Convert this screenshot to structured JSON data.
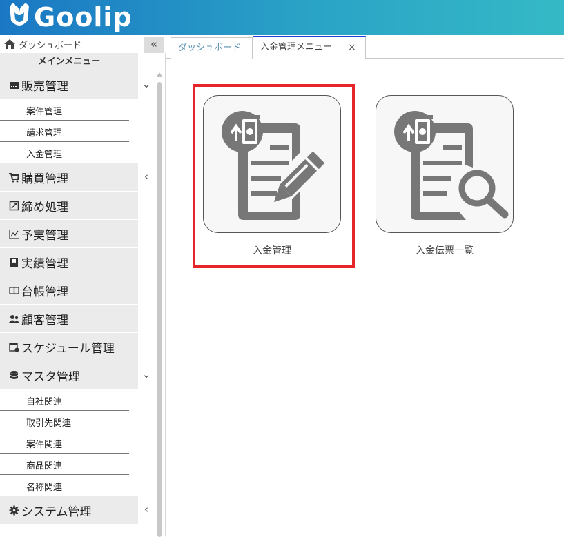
{
  "app": {
    "logo_text": "Goolip"
  },
  "sidebar": {
    "dashboard_label": "ダッシュボード",
    "collapse_label": "«",
    "main_menu_title": "メインメニュー",
    "categories": [
      {
        "label": "販売管理",
        "icon": "register-icon",
        "chevron": "⌄",
        "expanded": true,
        "items": [
          "案件管理",
          "請求管理",
          "入金管理"
        ]
      },
      {
        "label": "購買管理",
        "icon": "cart-icon",
        "chevron": "‹"
      },
      {
        "label": "締め処理",
        "icon": "checkbox-icon",
        "chevron": ""
      },
      {
        "label": "予実管理",
        "icon": "line-chart-icon",
        "chevron": ""
      },
      {
        "label": "実績管理",
        "icon": "bookmark-icon",
        "chevron": ""
      },
      {
        "label": "台帳管理",
        "icon": "book-icon",
        "chevron": ""
      },
      {
        "label": "顧客管理",
        "icon": "users-icon",
        "chevron": ""
      },
      {
        "label": "スケジュール管理",
        "icon": "calendar-icon",
        "chevron": ""
      },
      {
        "label": "マスタ管理",
        "icon": "database-icon",
        "chevron": "⌄",
        "expanded": true,
        "items": [
          "自社関連",
          "取引先関連",
          "案件関連",
          "商品関連",
          "名称関連"
        ]
      },
      {
        "label": "システム管理",
        "icon": "gear-icon",
        "chevron": "‹"
      }
    ]
  },
  "tabs": [
    {
      "label": "ダッシュボード",
      "active": false
    },
    {
      "label": "入金管理メニュー",
      "active": true,
      "close": "×"
    }
  ],
  "tiles": [
    {
      "label": "入金管理",
      "icon": "payment-edit-icon",
      "highlighted": true
    },
    {
      "label": "入金伝票一覧",
      "icon": "payment-search-icon",
      "highlighted": false
    }
  ],
  "colors": {
    "header_start": "#1a77c4",
    "header_end": "#35b9c6",
    "highlight": "#e5252a",
    "active_tab": "#1a3ed6",
    "icon_gray": "#777777"
  }
}
